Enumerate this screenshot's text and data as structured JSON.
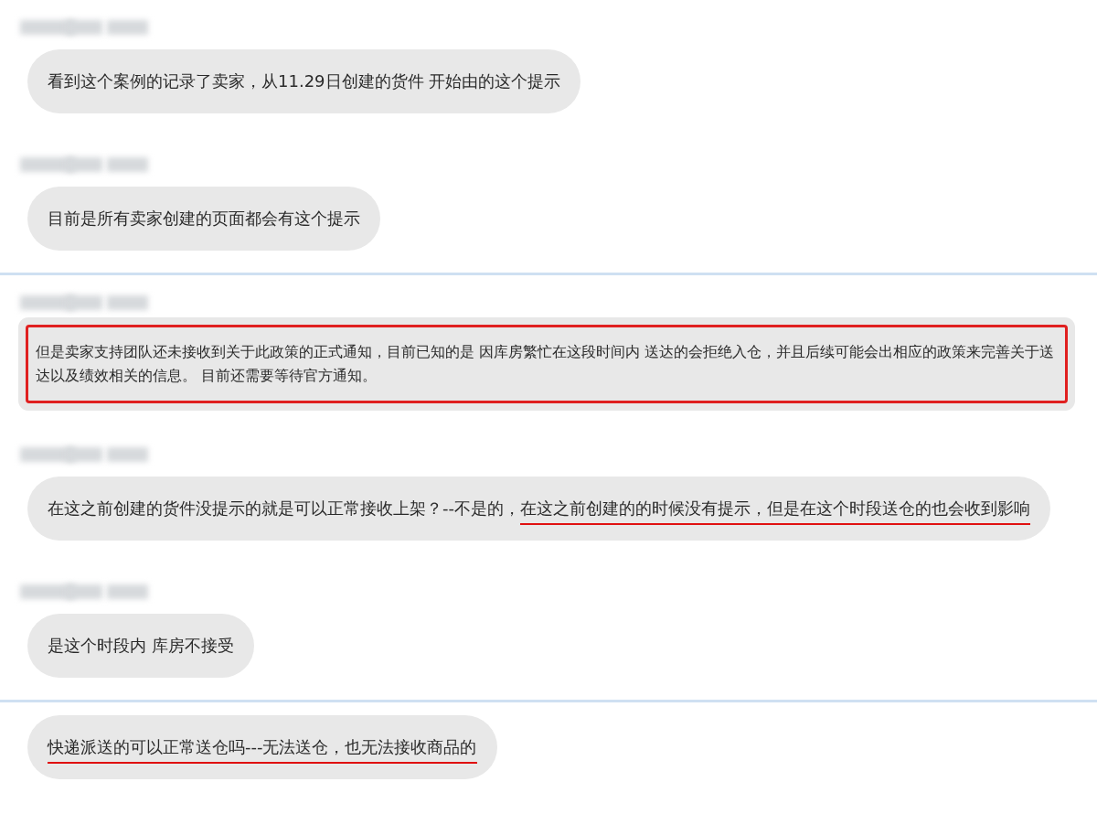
{
  "sections": [
    {
      "messages": [
        {
          "sender_redacted": true,
          "highlighted": false,
          "segments": [
            {
              "text": "看到这个案例的记录了卖家，从11.29日创建的货件 开始由的这个提示",
              "underlined": false
            }
          ]
        },
        {
          "sender_redacted": true,
          "highlighted": false,
          "segments": [
            {
              "text": "目前是所有卖家创建的页面都会有这个提示",
              "underlined": false
            }
          ]
        }
      ]
    },
    {
      "messages": [
        {
          "sender_redacted": true,
          "highlighted": true,
          "segments": [
            {
              "text": "但是卖家支持团队还未接收到关于此政策的正式通知，目前已知的是 因库房繁忙在这段时间内 送达的会拒绝入仓，并且后续可能会出相应的政策来完善关于送达以及绩效相关的信息。 目前还需要等待官方通知。",
              "underlined": false
            }
          ]
        },
        {
          "sender_redacted": true,
          "highlighted": false,
          "segments": [
            {
              "text": "在这之前创建的货件没提示的就是可以正常接收上架？--不是的，",
              "underlined": false
            },
            {
              "text": "在这之前创建的的时候没有提示，但是在这个时段送仓的也",
              "underlined": true
            },
            {
              "text": "会收到影响",
              "underlined": true
            }
          ]
        },
        {
          "sender_redacted": true,
          "highlighted": false,
          "segments": [
            {
              "text": "是这个时段内 库房不接受",
              "underlined": false
            }
          ]
        }
      ]
    },
    {
      "messages": [
        {
          "sender_redacted": false,
          "highlighted": false,
          "segments": [
            {
              "text": "快递派送的可以正常送仓吗---无法送仓，也无法接收商品的",
              "underlined": true
            }
          ]
        }
      ]
    }
  ]
}
